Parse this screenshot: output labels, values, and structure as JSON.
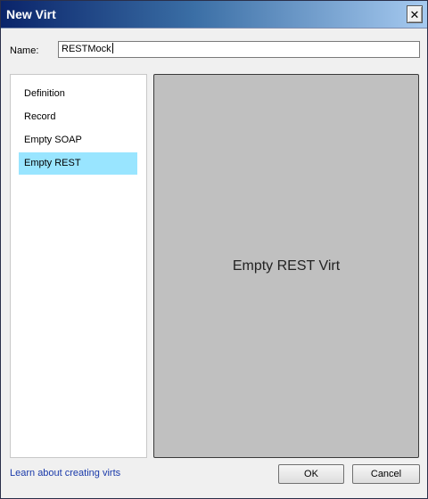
{
  "window": {
    "title": "New Virt",
    "close_glyph": "✕",
    "close_icon": "close-icon"
  },
  "name_field": {
    "label": "Name:",
    "value": "RESTMock"
  },
  "virt_types": [
    {
      "label": "Definition",
      "selected": false
    },
    {
      "label": "Record",
      "selected": false
    },
    {
      "label": "Empty SOAP",
      "selected": false
    },
    {
      "label": "Empty REST",
      "selected": true
    }
  ],
  "preview": {
    "text": "Empty REST Virt"
  },
  "footer": {
    "learn_link": "Learn about creating virts",
    "ok_label": "OK",
    "cancel_label": "Cancel"
  },
  "colors": {
    "title_gradient_start": "#0a246a",
    "selection": "#99e5ff",
    "preview_bg": "#c0c0c0",
    "link": "#1a3aaa"
  }
}
